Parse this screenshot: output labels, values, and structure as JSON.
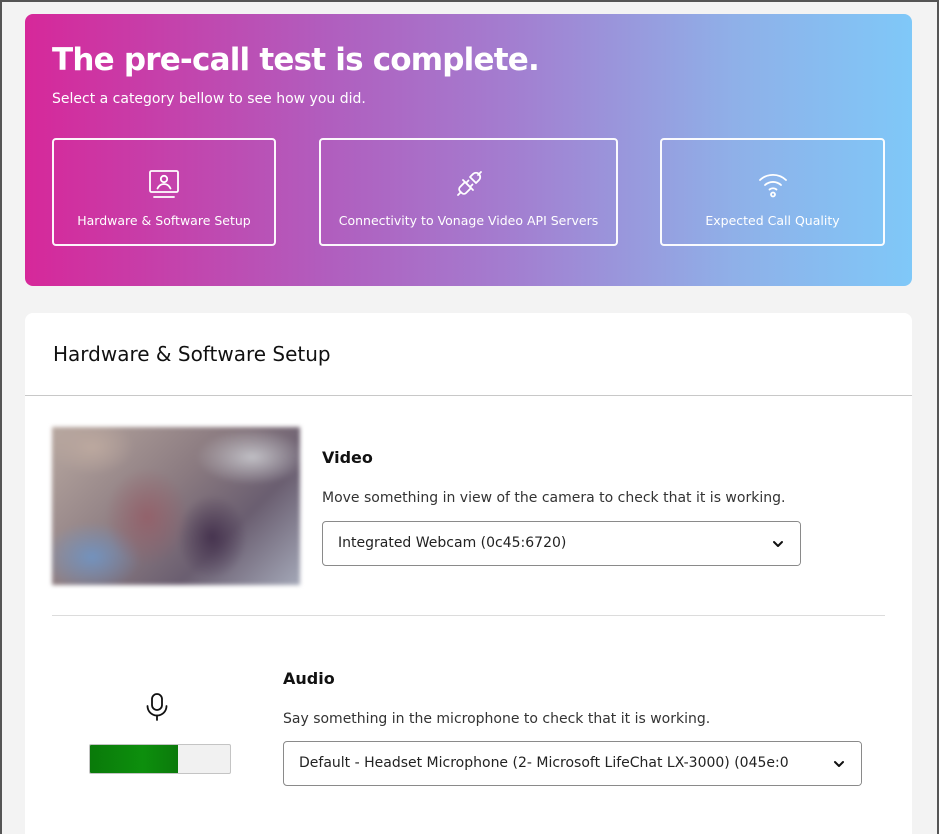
{
  "hero": {
    "title": "The pre-call test is complete.",
    "subtitle": "Select a category bellow to see how you did.",
    "categories": [
      {
        "label": "Hardware & Software Setup",
        "icon": "monitor-user-icon"
      },
      {
        "label": "Connectivity to Vonage Video API Servers",
        "icon": "plug-icon"
      },
      {
        "label": "Expected Call Quality",
        "icon": "wifi-icon"
      }
    ]
  },
  "card": {
    "title": "Hardware & Software Setup",
    "video": {
      "title": "Video",
      "description": "Move something in view of the camera to check that it is working.",
      "selected_device": "Integrated Webcam (0c45:6720)"
    },
    "audio": {
      "title": "Audio",
      "description": "Say something in the microphone to check that it is working.",
      "selected_device": "Default - Headset Microphone (2- Microsoft LifeChat LX-3000) (045e:0",
      "level_fraction": 0.63
    }
  },
  "colors": {
    "gradient_start": "#d6289a",
    "gradient_end": "#7fc8f8",
    "meter_green": "#0d8f0d"
  }
}
